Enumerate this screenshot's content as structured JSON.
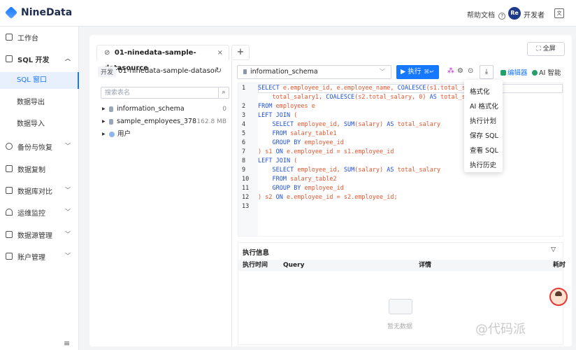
{
  "header": {
    "brand": "NineData",
    "help_label": "帮助文档",
    "help_icon": "?",
    "avatar_initials": "Re",
    "user_name": "开发者",
    "lang_icon": "文"
  },
  "sidebar": {
    "items": [
      {
        "label": "工作台",
        "icon": "home-icon"
      },
      {
        "label": "SQL 开发",
        "icon": "monitor-icon",
        "expanded": true
      },
      {
        "label": "SQL 窗口",
        "sub": true,
        "active": true
      },
      {
        "label": "数据导出",
        "sub": true
      },
      {
        "label": "数据导入",
        "sub": true
      },
      {
        "label": "备份与恢复",
        "icon": "backup-icon"
      },
      {
        "label": "数据复制",
        "icon": "copy-icon"
      },
      {
        "label": "数据库对比",
        "icon": "compare-icon"
      },
      {
        "label": "运维监控",
        "icon": "bell-icon"
      },
      {
        "label": "数据源管理",
        "icon": "database-icon"
      },
      {
        "label": "账户管理",
        "icon": "account-icon"
      }
    ],
    "collapse_icon": "≡"
  },
  "workspace": {
    "tab_label": "01-ninedata-sample-datasource",
    "tab_close": "×",
    "tab_add": "+",
    "fullscreen_label": "全屏",
    "env_badge": "开发",
    "datasource": "01-ninedata-sample-datasou...",
    "search_placeholder": "搜索表名",
    "tree": [
      {
        "name": "information_schema",
        "meta": "0",
        "type": "db"
      },
      {
        "name": "sample_employees_378",
        "meta": "162.8 MB",
        "type": "db"
      },
      {
        "name": "用户",
        "meta": "",
        "type": "user"
      }
    ]
  },
  "toolbar": {
    "schema": "information_schema",
    "run_label": "执行",
    "run_shortcut": "⌘↵",
    "editor_label": "编辑器",
    "ai_label": "AI 智能"
  },
  "editor": {
    "line_numbers": [
      "1",
      "2",
      "3",
      "4",
      "5",
      "6",
      "7",
      "8",
      "9",
      "10",
      "11",
      "12",
      "13"
    ]
  },
  "context_menu": [
    "格式化",
    "AI 格式化",
    "执行计划",
    "保存 SQL",
    "查看 SQL",
    "执行历史"
  ],
  "result": {
    "title": "执行信息",
    "columns": [
      "执行时间",
      "Query",
      "详情",
      "耗时"
    ],
    "empty_text": "暂无数据"
  },
  "watermark": "@代码派",
  "colors": {
    "accent": "#1677ff",
    "keyword": "#1d4ed8",
    "string": "#e3562f"
  }
}
